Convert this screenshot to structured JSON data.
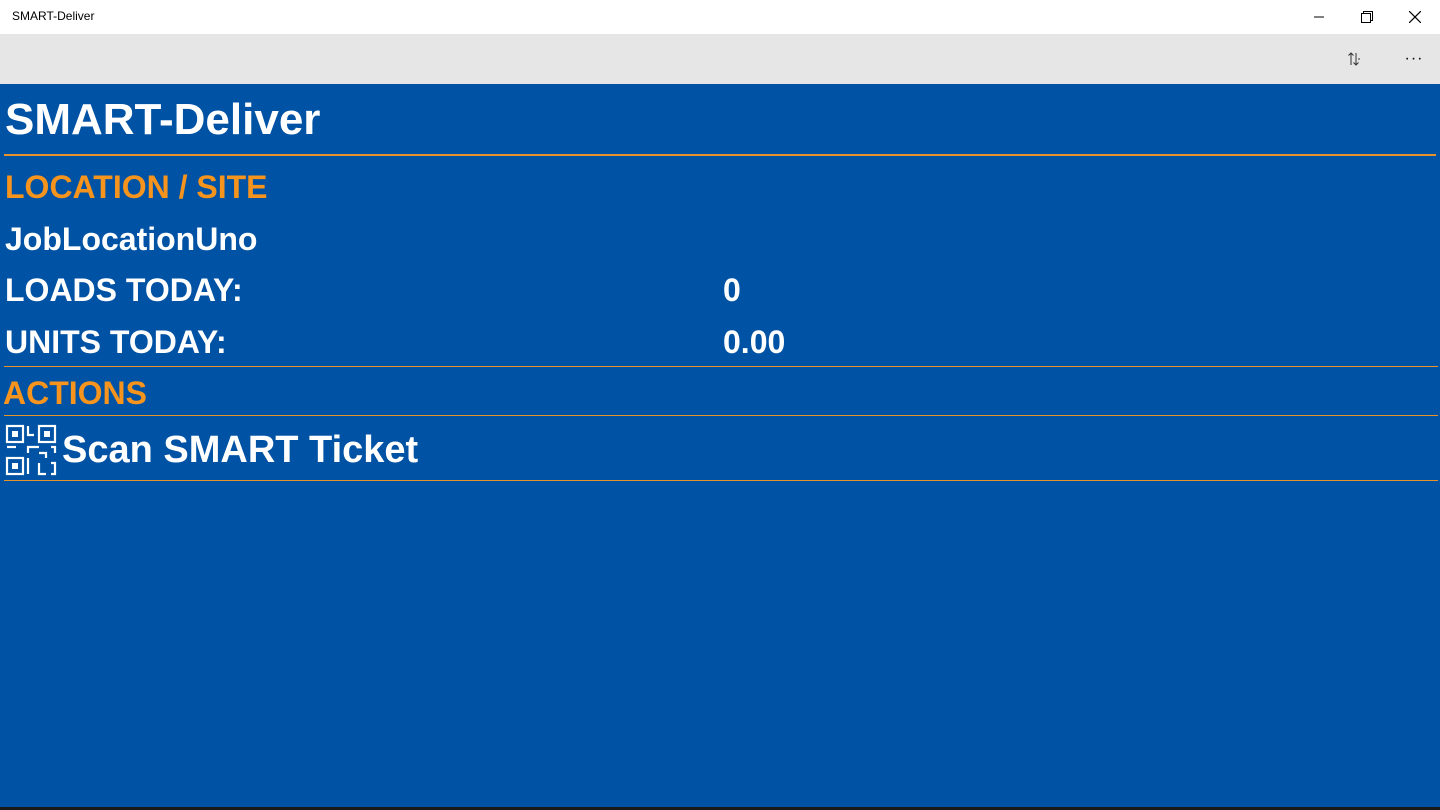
{
  "window": {
    "title": "SMART-Deliver"
  },
  "appbar": {
    "sort_icon": "sort-icon",
    "more_icon": "more-icon",
    "more_label": "···"
  },
  "main": {
    "app_title": "SMART-Deliver",
    "location_header": "LOCATION / SITE",
    "location_value": "JobLocationUno",
    "loads_label": "LOADS TODAY:",
    "loads_value": "0",
    "units_label": "UNITS TODAY:",
    "units_value": "0.00",
    "actions_header": "ACTIONS",
    "scan_label": "Scan SMART Ticket",
    "scan_icon": "qr-code-icon"
  },
  "colors": {
    "background": "#0052a4",
    "accent": "#f7941d",
    "divider": "#e8922b",
    "appbar": "#e6e6e6"
  }
}
